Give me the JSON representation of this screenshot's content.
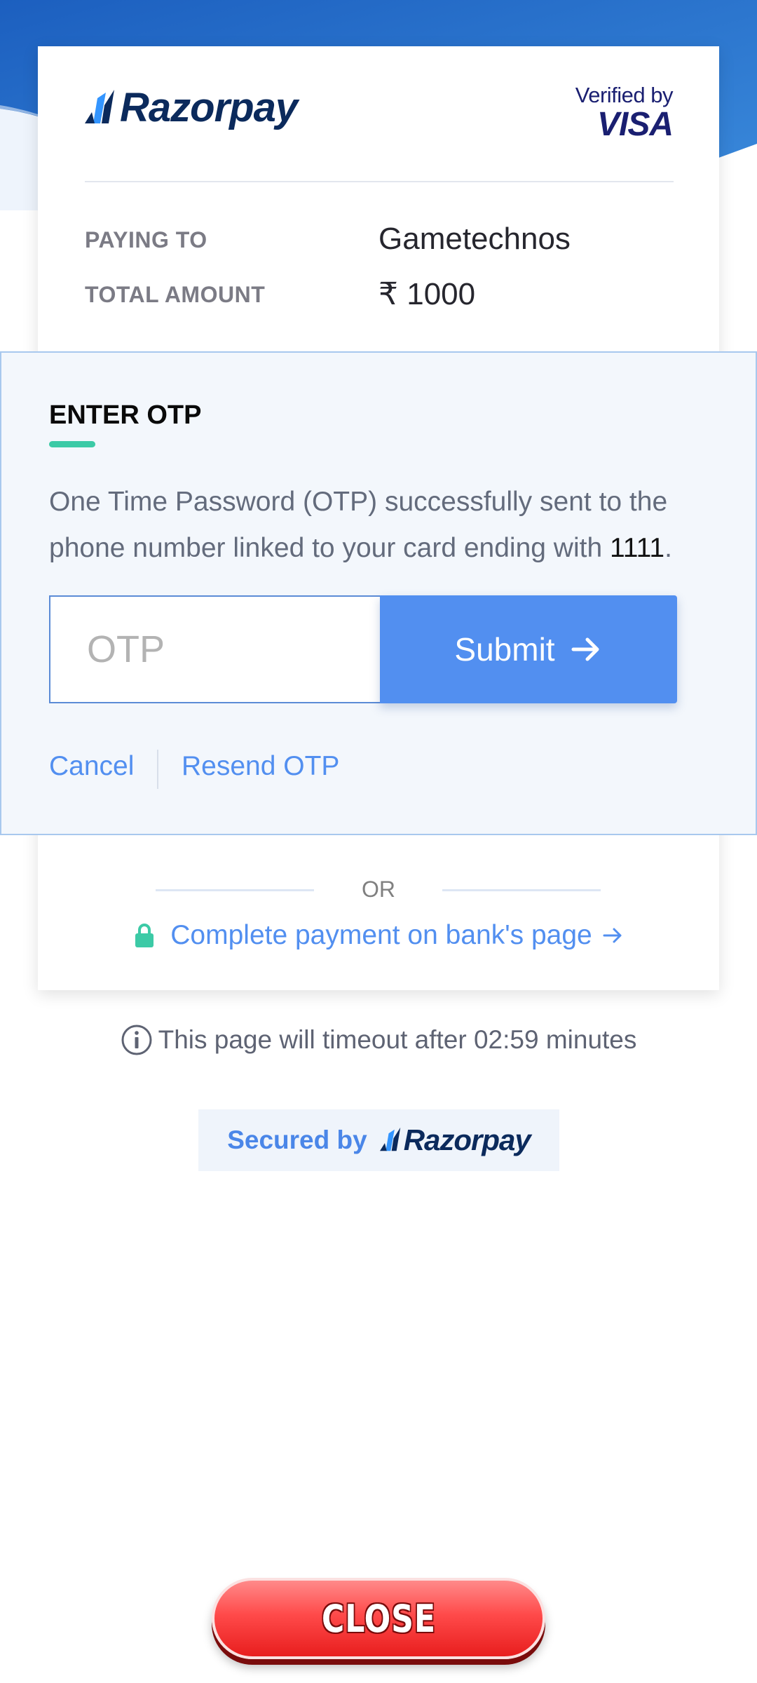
{
  "brand": {
    "name": "Razorpay",
    "primary": "#0b2a5c",
    "accent": "#528ff0",
    "success": "#3ccaa6"
  },
  "verified": {
    "line1": "Verified by",
    "line2": "VISA"
  },
  "summary": {
    "paying_to_label": "PAYING TO",
    "paying_to_value": "Gametechnos",
    "total_label": "TOTAL AMOUNT",
    "total_value": "₹ 1000"
  },
  "otp": {
    "title": "ENTER OTP",
    "message": "One Time Password (OTP) successfully sent to the phone number linked to your card ending with ",
    "card_last4": "1111",
    "message_end": ".",
    "input_placeholder": "OTP",
    "input_value": "",
    "submit_label": "Submit",
    "cancel_label": "Cancel",
    "resend_label": "Resend OTP"
  },
  "alternate": {
    "or_label": "OR",
    "bank_link": "Complete payment on bank's page"
  },
  "timeout": "This page will timeout after 02:59 minutes",
  "secured_by": "Secured by",
  "close_label": "CLOSE",
  "icons": [
    "razorpay-logo-icon",
    "lock-icon",
    "arrow-right-icon",
    "info-icon"
  ]
}
